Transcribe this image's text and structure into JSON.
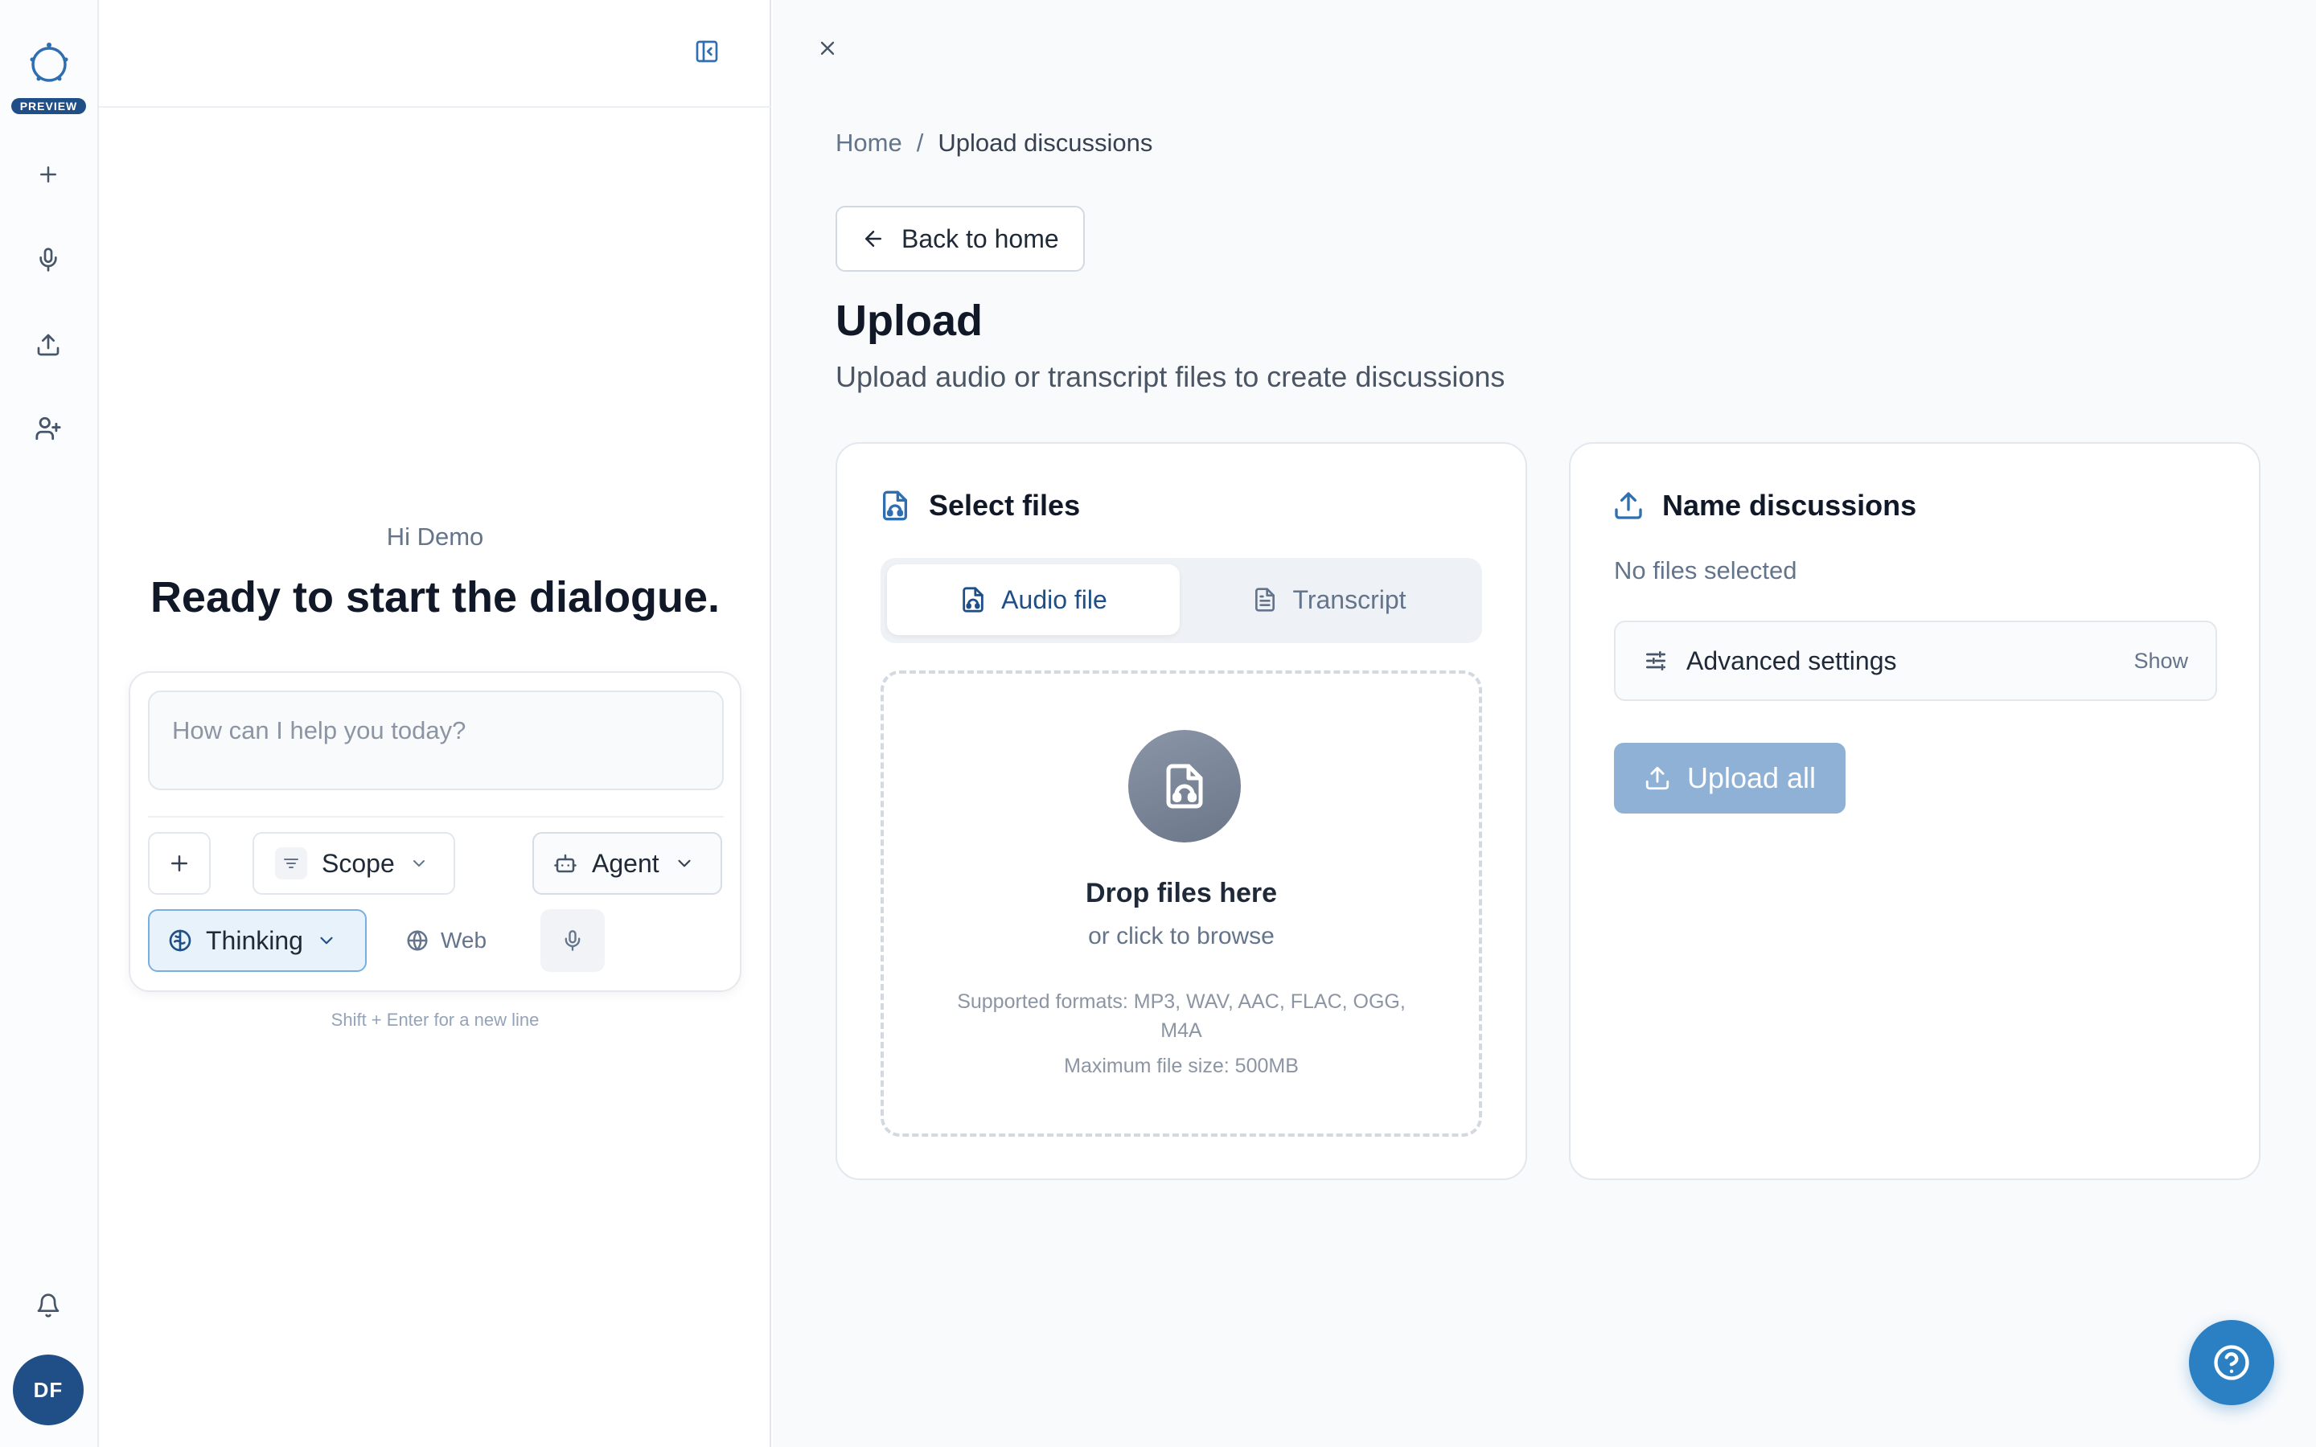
{
  "rail": {
    "badge": "PREVIEW",
    "avatar_initials": "DF",
    "items": [
      {
        "icon": "plus-icon"
      },
      {
        "icon": "microphone-icon"
      },
      {
        "icon": "upload-icon"
      },
      {
        "icon": "user-plus-icon"
      }
    ],
    "bottom_icon": "bell-icon"
  },
  "chat": {
    "greeting": "Hi Demo",
    "headline": "Ready to start the dialogue.",
    "input_placeholder": "How can I help you today?",
    "scope_label": "Scope",
    "agent_label": "Agent",
    "thinking_label": "Thinking",
    "web_label": "Web",
    "hint": "Shift + Enter for a new line"
  },
  "breadcrumb": {
    "home": "Home",
    "separator": "/",
    "current": "Upload discussions"
  },
  "back_button": "Back to home",
  "page": {
    "title": "Upload",
    "subtitle": "Upload audio or transcript files to create discussions"
  },
  "select_files": {
    "title": "Select files",
    "tabs": [
      {
        "label": "Audio file",
        "active": true
      },
      {
        "label": "Transcript",
        "active": false
      }
    ],
    "drop_title": "Drop files here",
    "drop_sub": "or click to browse",
    "formats": "Supported formats: MP3, WAV, AAC, FLAC, OGG, M4A",
    "max_size": "Maximum file size: 500MB"
  },
  "name_discussions": {
    "title": "Name discussions",
    "no_files": "No files selected",
    "advanced_label": "Advanced settings",
    "advanced_toggle": "Show",
    "upload_all": "Upload all"
  },
  "colors": {
    "brand": "#1f4f86",
    "accent": "#2b7fc3",
    "upload_disabled": "#8fb1d6",
    "thinking_bg": "#e8f2fb"
  }
}
